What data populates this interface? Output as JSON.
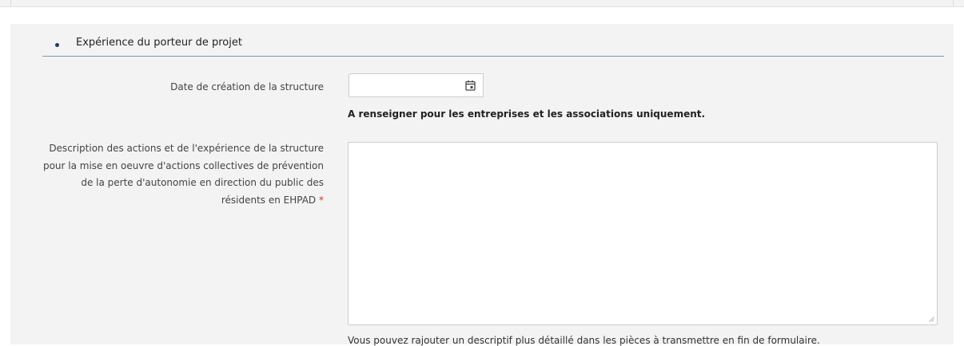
{
  "section": {
    "title": "Expérience du porteur de projet",
    "bullet_icon": "bullet-icon"
  },
  "fields": {
    "creation_date": {
      "label": "Date de création de la structure",
      "value": "",
      "button_icon": "calendar-icon",
      "help": "A renseigner pour les entreprises et les associations uniquement."
    },
    "description": {
      "label": "Description des actions et de l'expérience de la structure pour la mise en oeuvre d'actions collectives de prévention de la perte d'autonomie en direction du public des résidents en EHPAD",
      "required_marker": "*",
      "value": "",
      "help": "Vous pouvez rajouter un descriptif plus détaillé dans les pièces à transmettre en fin de formulaire."
    }
  },
  "colors": {
    "panel_background": "#f3f3f3",
    "header_rule": "#8094b4",
    "bullet": "#1e3a6e",
    "required": "#c0392b"
  }
}
